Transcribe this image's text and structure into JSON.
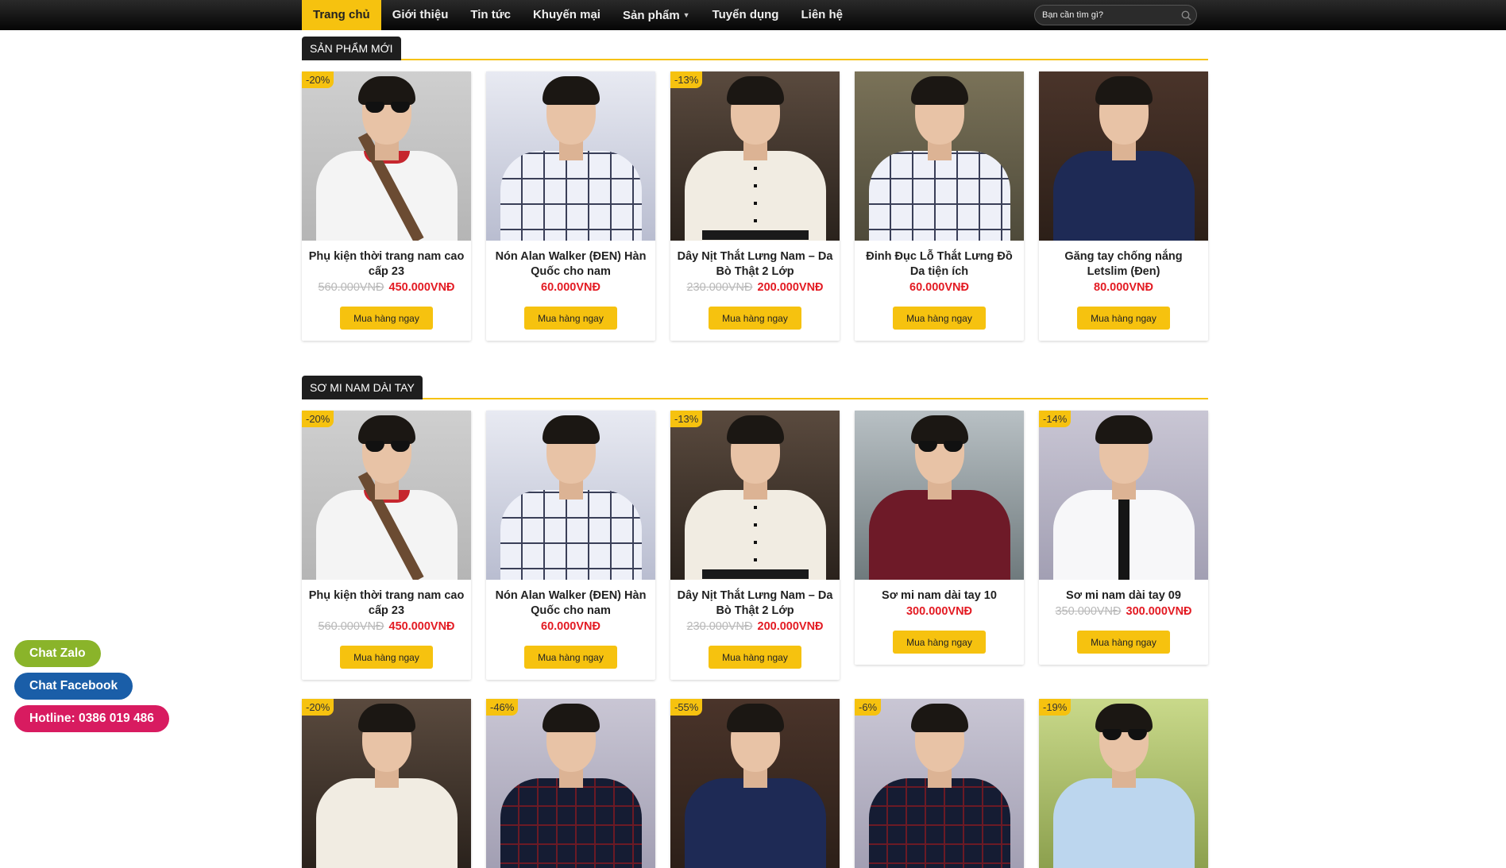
{
  "nav": {
    "items": [
      {
        "label": "Trang chủ",
        "active": true
      },
      {
        "label": "Giới thiệu"
      },
      {
        "label": "Tin tức"
      },
      {
        "label": "Khuyến mại"
      },
      {
        "label": "Sản phẩm",
        "dropdown": true
      },
      {
        "label": "Tuyển dụng"
      },
      {
        "label": "Liên hệ"
      }
    ],
    "search_placeholder": "Bạn cần tìm gì?"
  },
  "sections": [
    {
      "title": "SẢN PHẨM MỚI",
      "products": [
        {
          "name": "Phụ kiện thời trang nam cao cấp 23",
          "badge": "-20%",
          "old_price": "560.000VNĐ",
          "price": "450.000VNĐ",
          "button": "Mua hàng ngay"
        },
        {
          "name": "Nón Alan Walker (ĐEN) Hàn Quốc cho nam",
          "badge": "",
          "old_price": "",
          "price": "60.000VNĐ",
          "button": "Mua hàng ngay"
        },
        {
          "name": "Dây Nịt Thắt Lưng Nam – Da Bò Thật 2 Lớp",
          "badge": "-13%",
          "old_price": "230.000VNĐ",
          "price": "200.000VNĐ",
          "button": "Mua hàng ngay"
        },
        {
          "name": "Đinh Đục Lỗ Thắt Lưng Đồ Da tiện ích",
          "badge": "",
          "old_price": "",
          "price": "60.000VNĐ",
          "button": "Mua hàng ngay"
        },
        {
          "name": "Găng tay chống nắng Letslim (Đen)",
          "badge": "",
          "old_price": "",
          "price": "80.000VNĐ",
          "button": "Mua hàng ngay"
        }
      ]
    },
    {
      "title": "SƠ MI NAM DÀI TAY",
      "products": [
        {
          "name": "Phụ kiện thời trang nam cao cấp 23",
          "badge": "-20%",
          "old_price": "560.000VNĐ",
          "price": "450.000VNĐ",
          "button": "Mua hàng ngay"
        },
        {
          "name": "Nón Alan Walker (ĐEN) Hàn Quốc cho nam",
          "badge": "",
          "old_price": "",
          "price": "60.000VNĐ",
          "button": "Mua hàng ngay"
        },
        {
          "name": "Dây Nịt Thắt Lưng Nam – Da Bò Thật 2 Lớp",
          "badge": "-13%",
          "old_price": "230.000VNĐ",
          "price": "200.000VNĐ",
          "button": "Mua hàng ngay"
        },
        {
          "name": "Sơ mi nam dài tay 10",
          "badge": "",
          "old_price": "",
          "price": "300.000VNĐ",
          "button": "Mua hàng ngay"
        },
        {
          "name": "Sơ mi nam dài tay 09",
          "badge": "-14%",
          "old_price": "350.000VNĐ",
          "price": "300.000VNĐ",
          "button": "Mua hàng ngay"
        }
      ]
    }
  ],
  "third_row_badges": [
    "-20%",
    "-46%",
    "-55%",
    "-6%",
    "-19%"
  ],
  "chat": {
    "zalo": "Chat Zalo",
    "facebook": "Chat Facebook",
    "hotline": "Hotline: 0386 019 486"
  },
  "colors": {
    "accent": "#f6c20f",
    "price": "#e31b23",
    "zalo": "#8ab42a",
    "facebook": "#1a5ea8",
    "hotline": "#d81b60"
  }
}
